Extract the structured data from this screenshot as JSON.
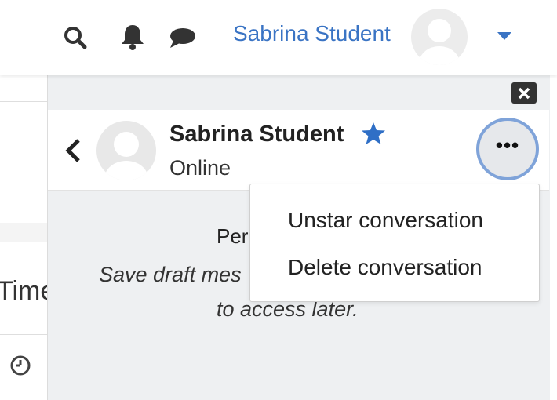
{
  "navbar": {
    "username": "Sabrina Student",
    "icons": [
      "search-icon",
      "bell-icon",
      "chat-icon",
      "avatar",
      "caret-down-icon"
    ]
  },
  "page": {
    "partial_label": "Time"
  },
  "drawer": {
    "close_icon": "close-icon",
    "conversation": {
      "name": "Sabrina Student",
      "status": "Online",
      "starred": true
    },
    "info": {
      "title_partial": "Per",
      "body_line1": "Save draft mes",
      "body_line2": "to access later."
    }
  },
  "menu": {
    "items": [
      {
        "label": "Unstar conversation"
      },
      {
        "label": "Delete conversation"
      }
    ]
  },
  "colors": {
    "accent": "#3a74c4",
    "star": "#2f6fc6",
    "focus_ring": "#7fa3d9"
  }
}
